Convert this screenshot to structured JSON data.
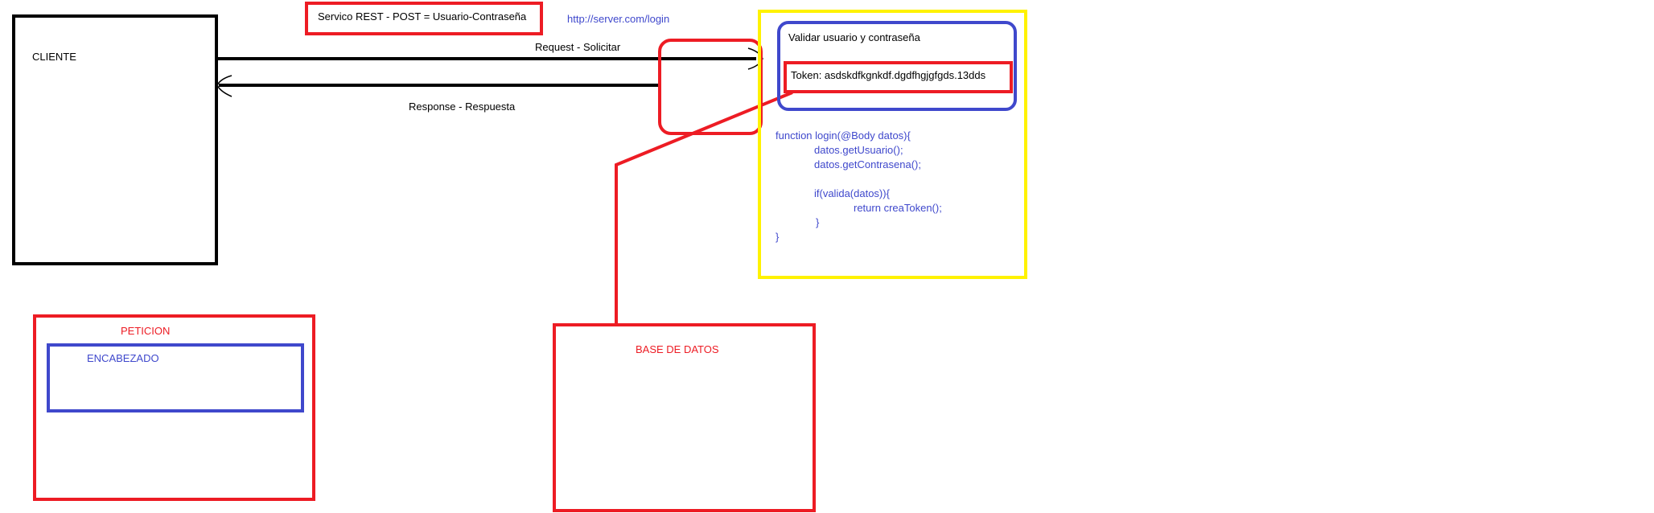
{
  "colors": {
    "black": "#000000",
    "red": "#ed1c24",
    "blue": "#3f48cc",
    "yellow": "#fff200",
    "link_blue": "#3f48cc"
  },
  "client": {
    "label": "CLIENTE"
  },
  "service_label": "Servico REST - POST = Usuario-Contraseña",
  "endpoint_url": "http://server.com/login",
  "request_label": "Request - Solicitar",
  "response_label": "Response - Respuesta",
  "server": {
    "validate_label": "Validar usuario y contraseña",
    "token_label": "Token: asdskdfkgnkdf.dgdfhgjgfgds.13dds",
    "code_lines": [
      "function  login(@Body datos){",
      "datos.getUsuario();",
      "datos.getContrasena();",
      "",
      "if(valida(datos)){",
      "return creaToken();",
      "}",
      "}"
    ]
  },
  "request_box": {
    "label": "PETICION",
    "header_label": "ENCABEZADO"
  },
  "database": {
    "label": "BASE DE DATOS"
  }
}
